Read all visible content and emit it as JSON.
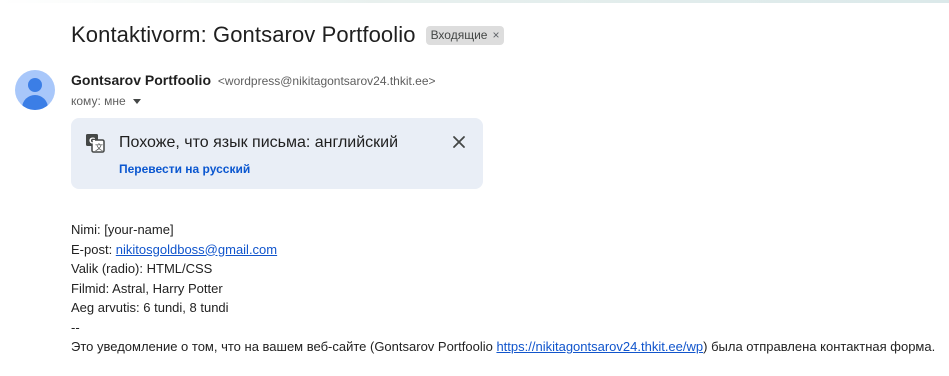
{
  "email": {
    "subject": "Kontaktivorm: Gontsarov Portfoolio",
    "label": "Входящие",
    "label_close": "×",
    "sender_name": "Gontsarov Portfoolio",
    "sender_email": "<wordpress@nikitagontsarov24.thkit.ee>",
    "to_line": "кому: мне"
  },
  "translate_bar": {
    "message": "Похоже, что язык письма: английский",
    "action": "Перевести на русский"
  },
  "body": {
    "name_label": "Nimi: ",
    "name_value": "[your-name]",
    "email_label": "E-post: ",
    "email_value": "nikitosgoldboss@gmail.com",
    "choice_line": "Valik (radio): HTML/CSS",
    "movies_line": "Filmid: Astral, Harry Potter",
    "time_line": "Aeg arvutis: 6 tundi, 8 tundi",
    "separator": "--",
    "notice_before": "Это уведомление о том, что на вашем веб-сайте (Gontsarov Portfoolio ",
    "notice_link": "https://nikitagontsarov24.thkit.ee/wp",
    "notice_after": ") была отправлена контактная форма."
  },
  "icons": {
    "avatar": "avatar-person-icon",
    "translate": "translate-icon",
    "close": "close-icon",
    "caret": "chevron-down-icon"
  },
  "colors": {
    "translate_bg": "#e9eef6",
    "link": "#1155cc",
    "action_link": "#0b57d0",
    "avatar_bg": "#a8c7fa",
    "avatar_fg": "#3b7ee6",
    "label_bg": "#dddddd"
  }
}
